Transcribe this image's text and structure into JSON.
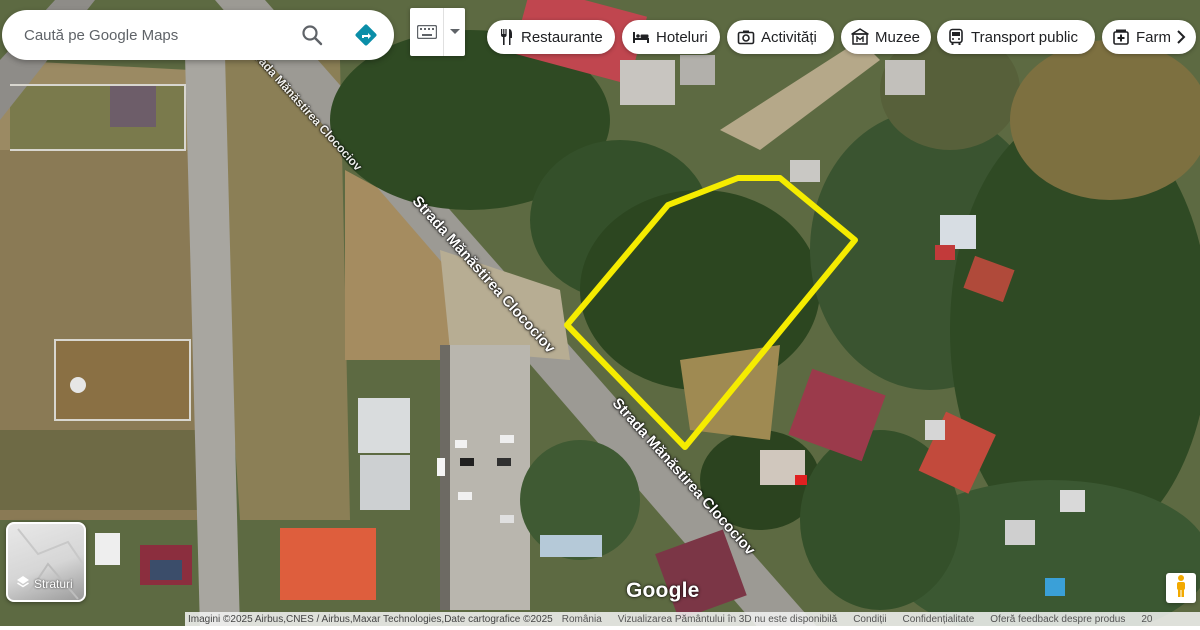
{
  "search": {
    "placeholder": "Caută pe Google Maps",
    "search_icon": "search-icon",
    "directions_icon": "directions-icon"
  },
  "keyboard": {
    "icon": "keyboard-icon",
    "dropdown_icon": "chevron-down-icon"
  },
  "chips": [
    {
      "label": "Restaurante",
      "icon": "fork-knife-icon"
    },
    {
      "label": "Hoteluri",
      "icon": "bed-icon"
    },
    {
      "label": "Activități",
      "icon": "camera-icon"
    },
    {
      "label": "Muzee",
      "icon": "museum-icon"
    },
    {
      "label": "Transport public",
      "icon": "bus-icon"
    },
    {
      "label": "Farm",
      "icon": "pharmacy-icon"
    }
  ],
  "chips_next_icon": "chevron-right-icon",
  "layers": {
    "label": "Straturi",
    "icon": "layers-icon"
  },
  "map": {
    "street_labels": [
      "Strada Mănăstirea Clocociov",
      "Strada Mănăstirea Clocociov",
      "Strada Mănăstirea Clocociov"
    ],
    "logo": "Google",
    "highlight_color": "#f5ec00"
  },
  "pegman_icon": "pegman-icon",
  "footer": {
    "attribution": "Imagini ©2025 Airbus,CNES / Airbus,Maxar Technologies,Date cartografice ©2025",
    "country": "România",
    "notice": "Vizualizarea Pământului în 3D nu este disponibilă",
    "terms": "Condiții",
    "privacy": "Confidențialitate",
    "feedback": "Oferă feedback despre produs",
    "scale": "20"
  }
}
